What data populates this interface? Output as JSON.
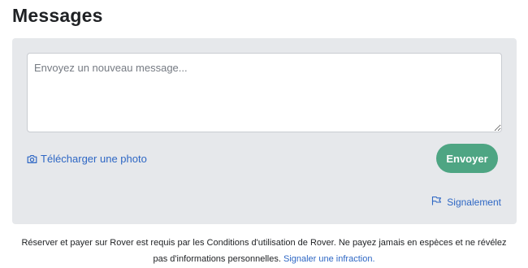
{
  "header": {
    "title": "Messages"
  },
  "composer": {
    "placeholder": "Envoyez un nouveau message...",
    "value": "",
    "upload_icon": "camera-icon",
    "upload_label": "Télécharger une photo",
    "send_label": "Envoyer",
    "report_icon": "flag-icon",
    "report_label": "Signalement"
  },
  "footer": {
    "notice": "Réserver et payer sur Rover est requis par les Conditions d'utilisation de Rover. Ne payez jamais en espèces et ne révélez pas d'informations personnelles.",
    "violation_link": "Signaler une infraction."
  },
  "colors": {
    "panel_background": "#e6e8eb",
    "send_button": "#4ea583",
    "link": "#2e67c4",
    "text": "#1f2124"
  }
}
